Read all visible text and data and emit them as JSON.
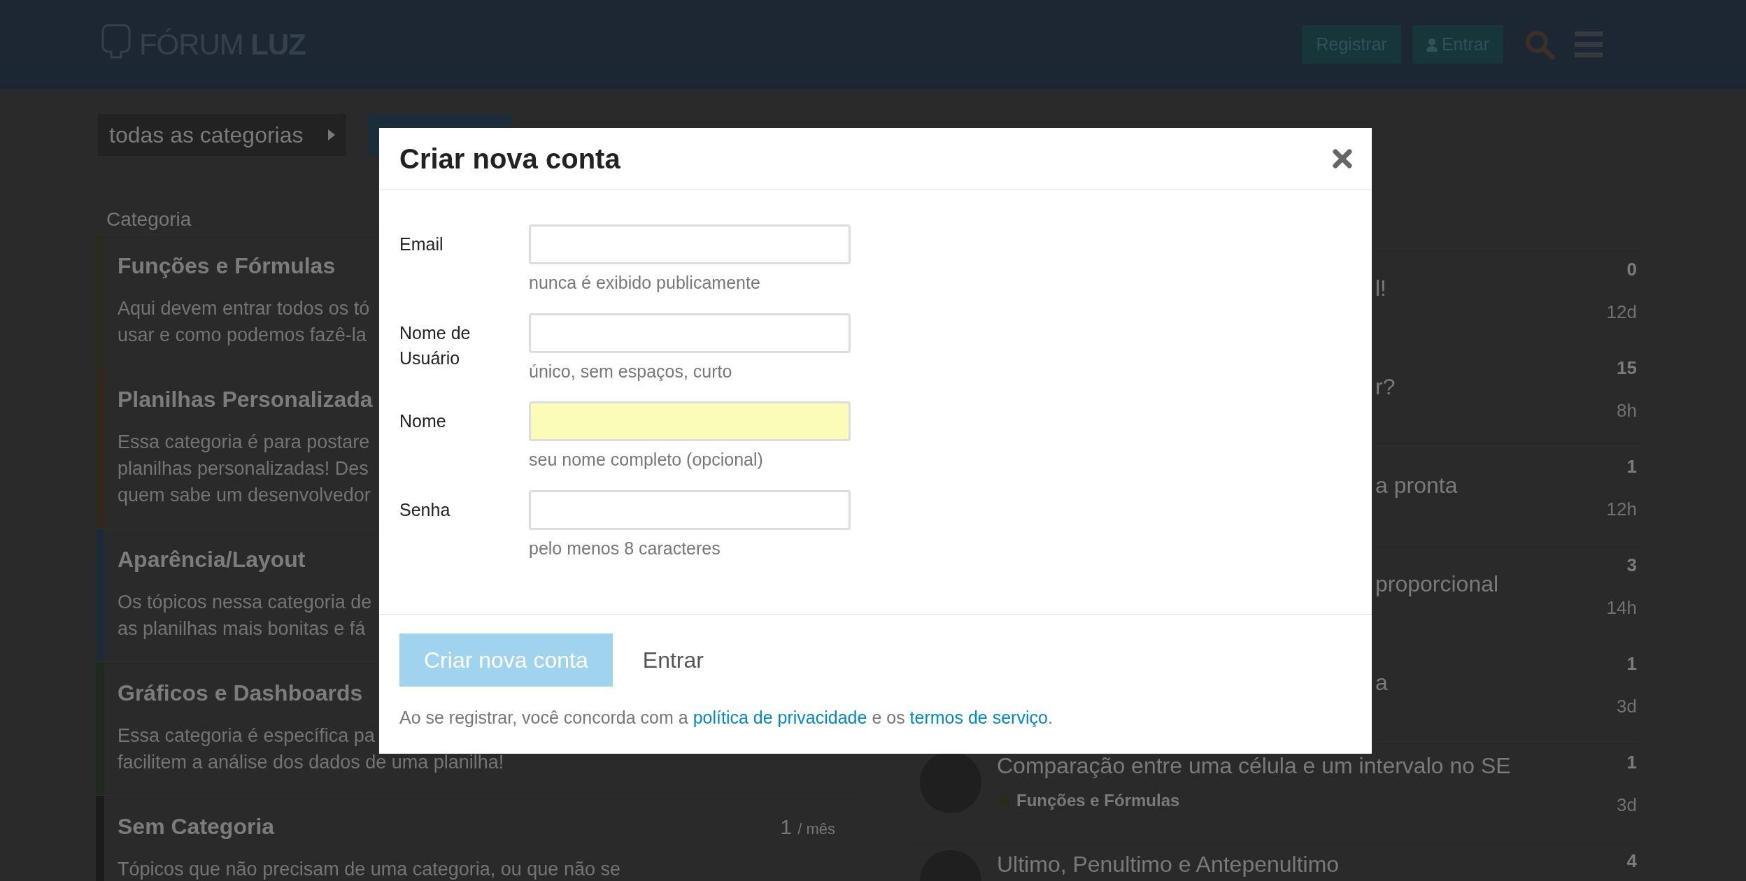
{
  "header": {
    "logo": {
      "light": "FÓRUM",
      "bold": "LUZ"
    },
    "buttons": [
      {
        "label": "Registrar",
        "kind": "plain"
      },
      {
        "label": "Entrar",
        "kind": "user"
      }
    ]
  },
  "navigation": {
    "category_dropdown": "todas as categorias"
  },
  "categories": {
    "heading": "Categoria",
    "items": [
      {
        "name": "Funções e Fórmulas",
        "color": "#2b2a1f",
        "description": [
          "Aqui devem entrar todos os tó",
          "usar e como podemos fazê-la"
        ]
      },
      {
        "name": "Planilhas Personalizada",
        "color": "#33271b",
        "description": [
          "Essa categoria é para postare",
          "planilhas personalizadas! Des",
          "quem sabe um desenvolvedor"
        ]
      },
      {
        "name": "Aparência/Layout",
        "color": "#1c2b35",
        "description": [
          "Os tópicos nessa categoria de",
          "as planilhas mais bonitas e fá"
        ]
      },
      {
        "name": "Gráficos e Dashboards",
        "color": "#1d2a1d",
        "description": [
          "Essa categoria é específica pa",
          "facilitem a análise dos dados de uma planilha!"
        ]
      },
      {
        "name": "Sem Categoria",
        "color": "#1a1a1a",
        "activity": {
          "count": "1",
          "unit": "/ mês"
        },
        "description": [
          "Tópicos que não precisam de uma categoria, ou que não se"
        ]
      }
    ]
  },
  "topics": [
    {
      "title": "l!",
      "partially_hidden": true,
      "avatar": false,
      "replies": "0",
      "age": "12d"
    },
    {
      "title": "r?",
      "partially_hidden": true,
      "avatar": false,
      "replies": "15",
      "age": "8h"
    },
    {
      "title": "a pronta",
      "partially_hidden": true,
      "avatar": false,
      "replies": "1",
      "age": "12h"
    },
    {
      "title": "proporcional",
      "partially_hidden": true,
      "avatar": false,
      "replies": "3",
      "age": "14h"
    },
    {
      "title": "a",
      "partially_hidden": true,
      "avatar": false,
      "replies": "1",
      "age": "3d"
    },
    {
      "title": "Comparação entre uma célula e um intervalo no SE",
      "partially_hidden": false,
      "avatar": true,
      "category": {
        "name": "Funções e Fórmulas",
        "color": "#2b2a1f"
      },
      "replies": "1",
      "age": "3d"
    },
    {
      "title": "Ultimo, Penultimo e Antepenultimo",
      "partially_hidden": false,
      "avatar": true,
      "replies": "4"
    }
  ],
  "modal": {
    "title": "Criar nova conta",
    "fields": [
      {
        "label": "Email",
        "hint": "nunca é exibido publicamente",
        "autofilled": false
      },
      {
        "label": "Nome de Usuário",
        "hint": "único, sem espaços, curto",
        "autofilled": false
      },
      {
        "label": "Nome",
        "hint": "seu nome completo (opcional)",
        "autofilled": true
      },
      {
        "label": "Senha",
        "hint": "pelo menos 8 caracteres",
        "autofilled": false
      }
    ],
    "primary_button": {
      "label": "Criar nova conta",
      "disabled": true
    },
    "secondary_button": "Entrar",
    "legal": [
      {
        "kind": "text",
        "text": "Ao se registrar, você concorda com a "
      },
      {
        "kind": "link",
        "text": "política de privacidade"
      },
      {
        "kind": "text",
        "text": " e os "
      },
      {
        "kind": "link",
        "text": "termos de serviço"
      },
      {
        "kind": "text",
        "text": "."
      }
    ]
  }
}
